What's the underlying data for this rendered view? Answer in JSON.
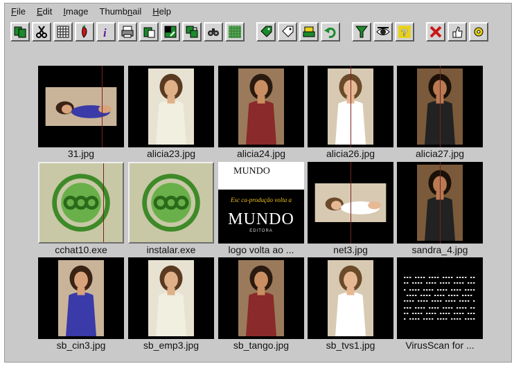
{
  "menu": [
    {
      "label": "File",
      "underline": "F",
      "rest": "ile"
    },
    {
      "label": "Edit",
      "underline": "E",
      "rest": "dit"
    },
    {
      "label": "Image",
      "underline": "I",
      "rest": "mage"
    },
    {
      "label": "Thumbnail",
      "pre": "Thumb",
      "underline": "n",
      "rest": "ail"
    },
    {
      "label": "Help",
      "underline": "H",
      "rest": "elp"
    }
  ],
  "toolbar": {
    "buttons": [
      "copy-icon",
      "cut-icon",
      "select-pattern-icon",
      "pepper-icon",
      "info-icon",
      "print-icon",
      "paste-icon",
      "resize-icon",
      "copy-to-icon",
      "binoculars-icon",
      "grid-icon",
      "tag-icon",
      "untag-icon",
      "scanner-icon",
      "undo-icon",
      "filter-icon",
      "eye-icon",
      "help-icon",
      "delete-icon",
      "thumbs-up-icon",
      "settings-icon"
    ],
    "colors": {
      "green": "#1a8a2a",
      "red": "#c81818",
      "purple": "#6a1a9a",
      "yellow": "#e8d21a",
      "dark": "#303030"
    }
  },
  "thumbnails": [
    {
      "name": "31.jpg",
      "kind": "photo-wide"
    },
    {
      "name": "alicia23.jpg",
      "kind": "photo"
    },
    {
      "name": "alicia24.jpg",
      "kind": "photo"
    },
    {
      "name": "alicia26.jpg",
      "kind": "photo"
    },
    {
      "name": "alicia27.jpg",
      "kind": "photo"
    },
    {
      "name": "cchat10.exe",
      "kind": "exe-icon"
    },
    {
      "name": "instalar.exe",
      "kind": "exe-icon"
    },
    {
      "name": "logo volta ao ...",
      "kind": "logo",
      "logo_top": "MUNDO",
      "logo_script": "Esc ca-produção volta a",
      "logo_big": "MUNDO",
      "logo_sub": "EDITORA"
    },
    {
      "name": "net3.jpg",
      "kind": "photo-wide"
    },
    {
      "name": "sandra_4.jpg",
      "kind": "photo"
    },
    {
      "name": "sb_cin3.jpg",
      "kind": "photo"
    },
    {
      "name": "sb_emp3.jpg",
      "kind": "photo"
    },
    {
      "name": "sb_tango.jpg",
      "kind": "photo"
    },
    {
      "name": "sb_tvs1.jpg",
      "kind": "photo"
    },
    {
      "name": "VirusScan for ...",
      "kind": "text-doc"
    }
  ]
}
